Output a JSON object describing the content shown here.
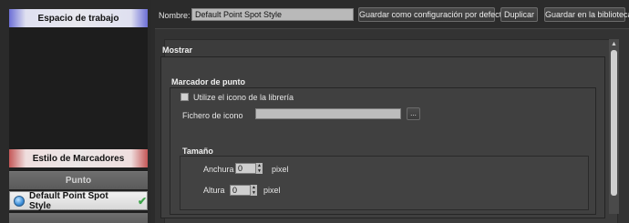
{
  "sidebar": {
    "workspace_header": "Espacio de trabajo",
    "markers_header": "Estilo de Marcadores",
    "category_header": "Punto",
    "selected_style": "Default Point Spot Style",
    "selected_icon": "point-dot-icon",
    "check_icon": "checkmark-icon"
  },
  "toolbar": {
    "name_label": "Nombre:",
    "name_value": "Default Point Spot Style",
    "save_default_label": "Guardar como configuración por defecto",
    "duplicate_label": "Duplicar",
    "save_library_label": "Guardar en la biblioteca"
  },
  "main": {
    "show_title": "Mostrar",
    "marker": {
      "title": "Marcador de punto",
      "use_library_icon_label": "Utilize el icono de la librería",
      "use_library_icon_checked": false,
      "icon_file_label": "Fichero de icono",
      "icon_file_value": "",
      "browse_label": "..."
    },
    "size": {
      "title": "Tamaño",
      "width_label": "Anchura",
      "width_value": "0",
      "width_unit": "pixel",
      "height_label": "Altura",
      "height_value": "0",
      "height_unit": "pixel"
    }
  },
  "colors": {
    "workspace_accent": "#6c6fd6",
    "markers_accent": "#c45757",
    "check": "#3da34a"
  }
}
